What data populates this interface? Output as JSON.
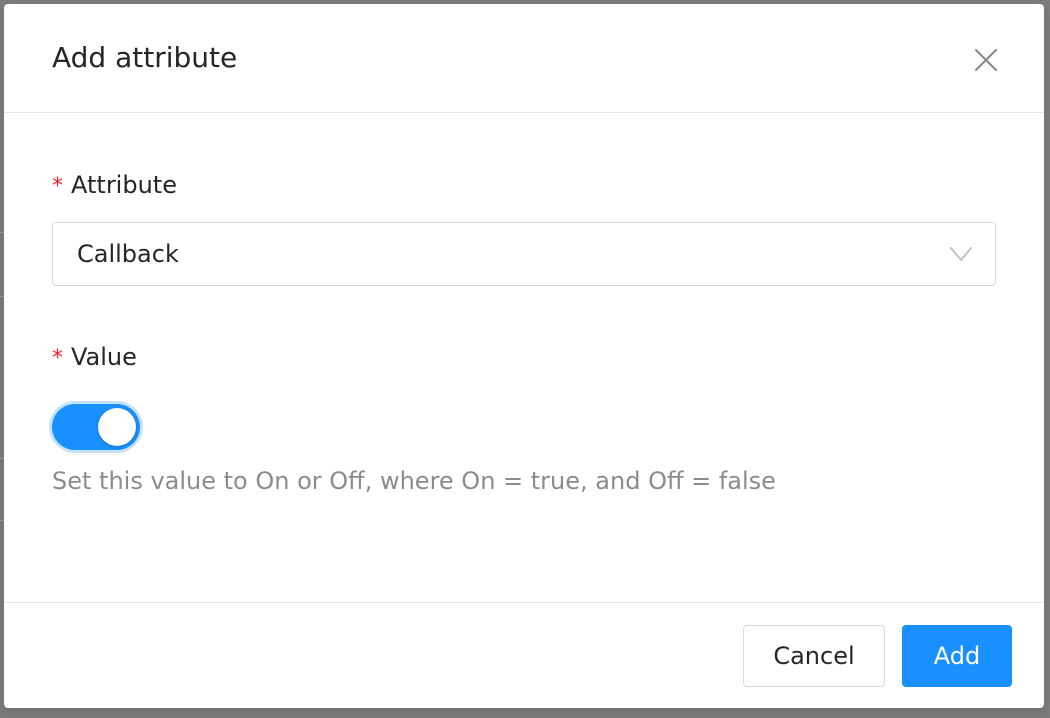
{
  "dialog": {
    "title": "Add attribute",
    "close_icon": "close-icon"
  },
  "form": {
    "attribute": {
      "required_mark": "*",
      "label": "Attribute",
      "selected_value": "Callback",
      "arrow_icon": "chevron-down-icon"
    },
    "value": {
      "required_mark": "*",
      "label": "Value",
      "switch_on": true,
      "help_text": "Set this value to On or Off, where On = true, and Off = false"
    }
  },
  "footer": {
    "cancel_label": "Cancel",
    "add_label": "Add"
  },
  "colors": {
    "primary": "#1890ff",
    "required": "#f5222d",
    "overlay": "#7d7d7d"
  }
}
